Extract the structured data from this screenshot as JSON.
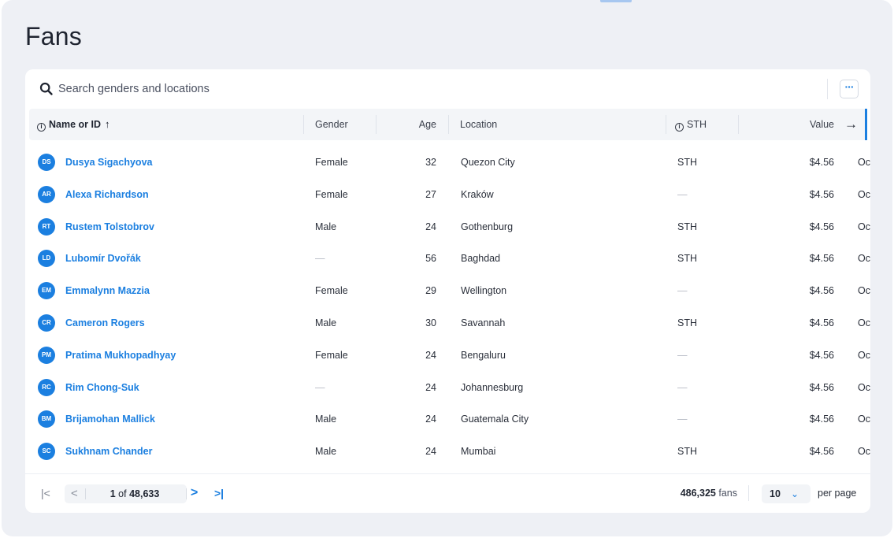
{
  "page": {
    "title": "Fans"
  },
  "search": {
    "placeholder": "Search genders and locations"
  },
  "table": {
    "columns": {
      "name": "Name or ID",
      "gender": "Gender",
      "age": "Age",
      "location": "Location",
      "sth": "STH",
      "value": "Value"
    },
    "sort": {
      "column": "name",
      "direction": "ascending"
    },
    "rows": [
      {
        "initials": "DS",
        "name": "Dusya Sigachyova",
        "gender": "Female",
        "age": "32",
        "location": "Quezon City",
        "sth": "STH",
        "value": "$4.56",
        "date": "Oc"
      },
      {
        "initials": "AR",
        "name": "Alexa Richardson",
        "gender": "Female",
        "age": "27",
        "location": "Kraków",
        "sth": "—",
        "value": "$4.56",
        "date": "Oc"
      },
      {
        "initials": "RT",
        "name": "Rustem Tolstobrov",
        "gender": "Male",
        "age": "24",
        "location": "Gothenburg",
        "sth": "STH",
        "value": "$4.56",
        "date": "Oc"
      },
      {
        "initials": "LD",
        "name": "Lubomír Dvořák",
        "gender": "—",
        "age": "56",
        "location": "Baghdad",
        "sth": "STH",
        "value": "$4.56",
        "date": "Oc"
      },
      {
        "initials": "EM",
        "name": "Emmalynn Mazzia",
        "gender": "Female",
        "age": "29",
        "location": "Wellington",
        "sth": "—",
        "value": "$4.56",
        "date": "Oc"
      },
      {
        "initials": "CR",
        "name": "Cameron Rogers",
        "gender": "Male",
        "age": "30",
        "location": "Savannah",
        "sth": "STH",
        "value": "$4.56",
        "date": "Oc"
      },
      {
        "initials": "PM",
        "name": "Pratima Mukhopadhyay",
        "gender": "Female",
        "age": "24",
        "location": "Bengaluru",
        "sth": "—",
        "value": "$4.56",
        "date": "Oc"
      },
      {
        "initials": "RC",
        "name": "Rim Chong-Suk",
        "gender": "—",
        "age": "24",
        "location": "Johannesburg",
        "sth": "—",
        "value": "$4.56",
        "date": "Oc"
      },
      {
        "initials": "BM",
        "name": "Brijamohan Mallick",
        "gender": "Male",
        "age": "24",
        "location": "Guatemala City",
        "sth": "—",
        "value": "$4.56",
        "date": "Oc"
      },
      {
        "initials": "SC",
        "name": "Sukhnam Chander",
        "gender": "Male",
        "age": "24",
        "location": "Mumbai",
        "sth": "STH",
        "value": "$4.56",
        "date": "Oc"
      }
    ]
  },
  "pagination": {
    "current_page": "1",
    "of_label": "of",
    "total_pages": "48,633",
    "total_count": "486,325",
    "total_unit": "fans",
    "per_page_value": "10",
    "per_page_label": "per page"
  },
  "colors": {
    "accent": "#1b7fe0",
    "background": "#eef0f5",
    "card": "#ffffff"
  },
  "icons": {
    "search": "search-icon",
    "more": "more-icon",
    "info": "info-icon",
    "sort": "arrow-up-icon",
    "scroll": "arrow-right-icon",
    "first": "first-page-icon",
    "prev": "chevron-left-icon",
    "next": "chevron-right-icon",
    "last": "last-page-icon",
    "dropdown": "chevron-down-icon"
  }
}
